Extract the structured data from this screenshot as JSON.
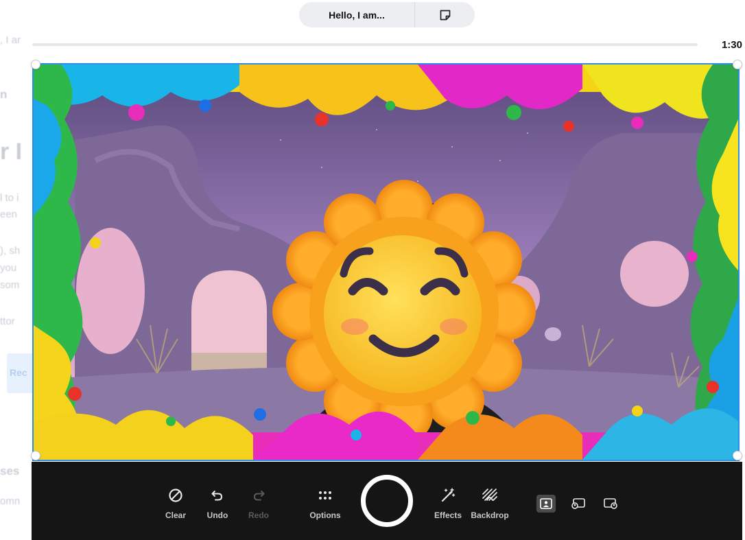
{
  "header": {
    "title": "Hello, I am...",
    "note_icon": "sticky-note-icon"
  },
  "progress": {
    "fraction": 0.0
  },
  "timer": "1:30",
  "background_page": {
    "lines": [
      ", I ar",
      "n",
      "r I",
      "l to i",
      "een",
      "), sh",
      "you",
      "som",
      "ttor",
      "ses",
      "omn"
    ],
    "button_label": "Rec"
  },
  "video": {
    "description_icon": "sun-face-emoji-icon"
  },
  "toolbar": {
    "clear": {
      "label": "Clear",
      "icon": "clear-icon"
    },
    "undo": {
      "label": "Undo",
      "icon": "undo-icon"
    },
    "redo": {
      "label": "Redo",
      "icon": "redo-icon"
    },
    "options": {
      "label": "Options",
      "icon": "options-grid-icon"
    },
    "effects": {
      "label": "Effects",
      "icon": "magic-wand-icon"
    },
    "backdrop": {
      "label": "Backdrop",
      "icon": "backdrop-icon"
    },
    "layouts": [
      "camera-only-layout-icon",
      "camera-left-layout-icon",
      "camera-right-layout-icon"
    ]
  },
  "colors": {
    "accent": "#2f8fe8",
    "toolbar_bg": "#151515",
    "record_ring": "#ffffff"
  }
}
